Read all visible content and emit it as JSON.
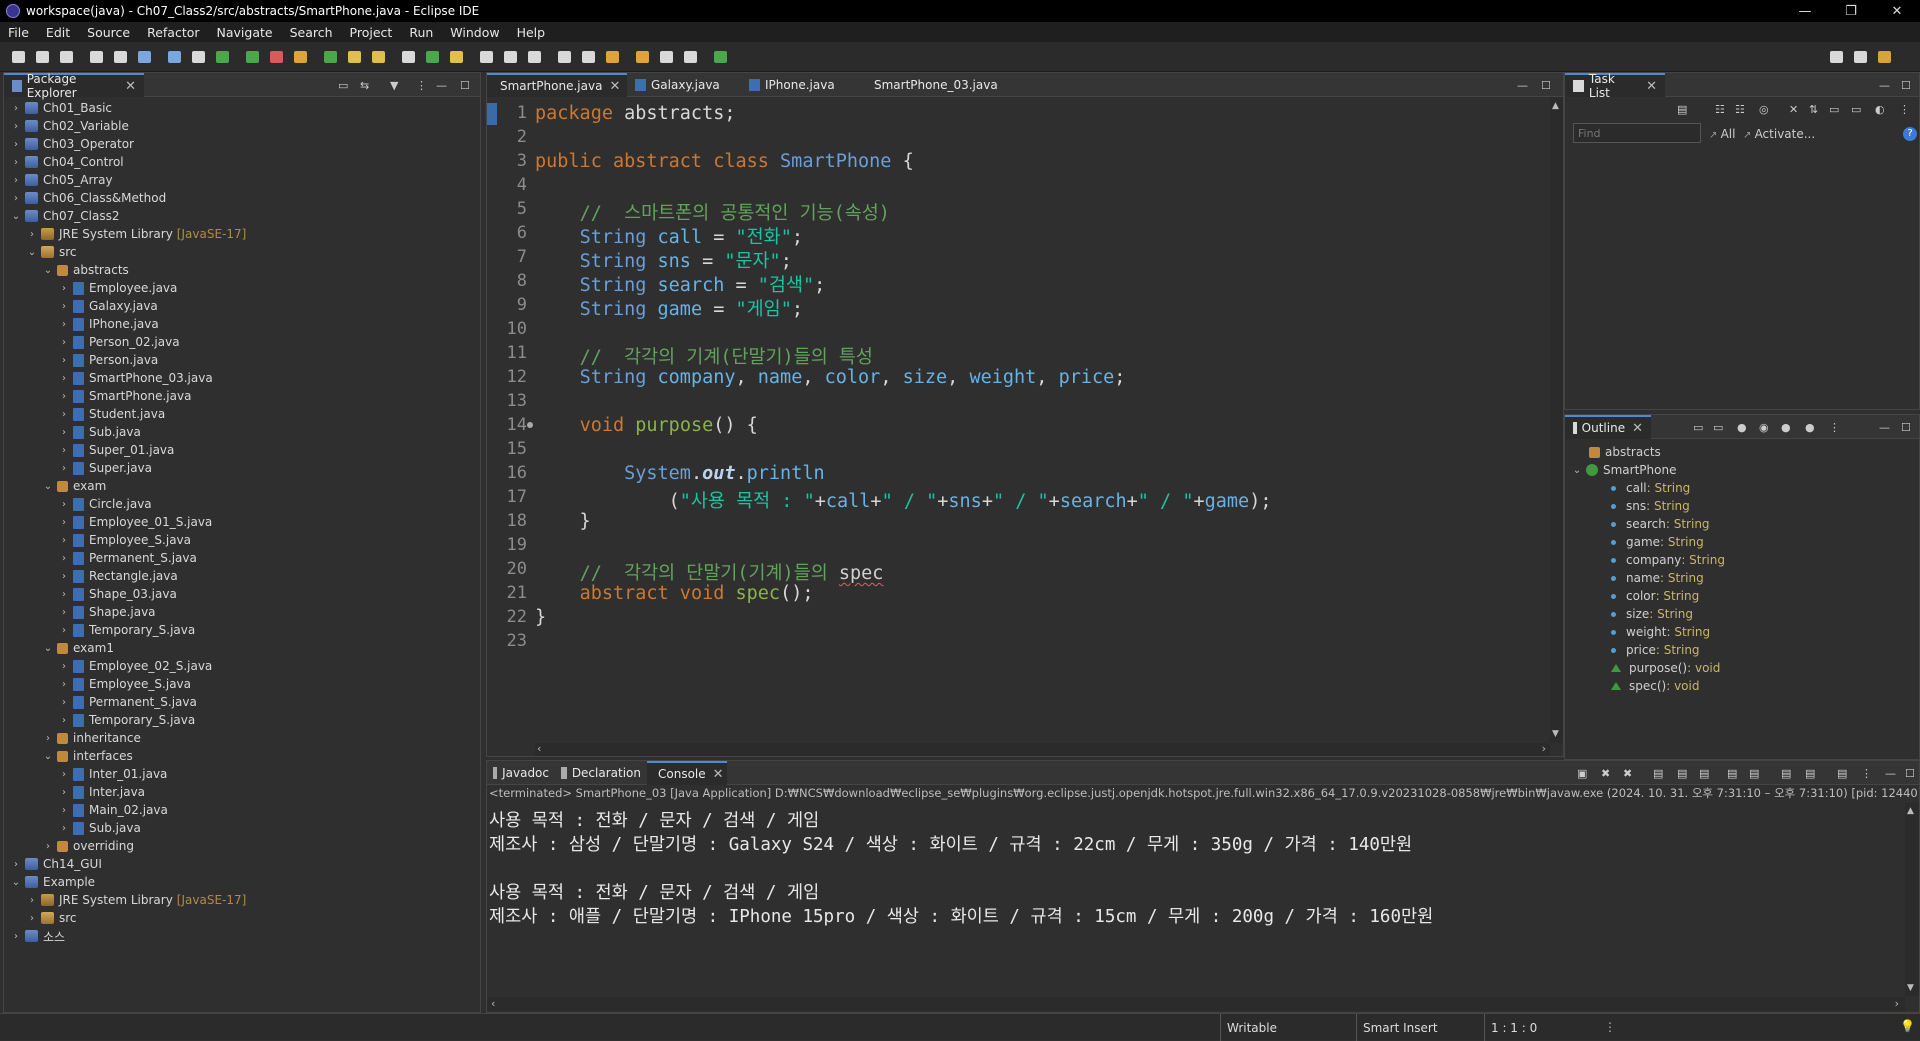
{
  "window": {
    "title": "workspace(java) - Ch07_Class2/src/abstracts/SmartPhone.java - Eclipse IDE",
    "min": "—",
    "max": "❐",
    "close": "✕"
  },
  "menu": [
    "File",
    "Edit",
    "Source",
    "Refactor",
    "Navigate",
    "Search",
    "Project",
    "Run",
    "Window",
    "Help"
  ],
  "explorer": {
    "title": "Package Explorer",
    "rows": [
      {
        "chev": "›",
        "icon": "proj",
        "label": "Ch01_Basic",
        "indent": 0
      },
      {
        "chev": "›",
        "icon": "proj",
        "label": "Ch02_Variable",
        "indent": 0
      },
      {
        "chev": "›",
        "icon": "proj",
        "label": "Ch03_Operator",
        "indent": 0
      },
      {
        "chev": "›",
        "icon": "proj",
        "label": "Ch04_Control",
        "indent": 0
      },
      {
        "chev": "›",
        "icon": "proj",
        "label": "Ch05_Array",
        "indent": 0
      },
      {
        "chev": "›",
        "icon": "proj",
        "label": "Ch06_Class&Method",
        "indent": 0
      },
      {
        "chev": "⌄",
        "icon": "proj",
        "label": "Ch07_Class2",
        "indent": 0
      },
      {
        "chev": "›",
        "icon": "jre",
        "label": "JRE System Library",
        "tag": "[JavaSE-17]",
        "indent": 1
      },
      {
        "chev": "⌄",
        "icon": "src",
        "label": "src",
        "indent": 1
      },
      {
        "chev": "⌄",
        "icon": "pkg",
        "label": "abstracts",
        "indent": 2
      },
      {
        "chev": "›",
        "icon": "java",
        "label": "Employee.java",
        "indent": 3
      },
      {
        "chev": "›",
        "icon": "java",
        "label": "Galaxy.java",
        "indent": 3
      },
      {
        "chev": "›",
        "icon": "java",
        "label": "IPhone.java",
        "indent": 3
      },
      {
        "chev": "›",
        "icon": "java",
        "label": "Person_02.java",
        "indent": 3
      },
      {
        "chev": "›",
        "icon": "java",
        "label": "Person.java",
        "indent": 3
      },
      {
        "chev": "›",
        "icon": "java",
        "label": "SmartPhone_03.java",
        "indent": 3
      },
      {
        "chev": "›",
        "icon": "java",
        "label": "SmartPhone.java",
        "indent": 3
      },
      {
        "chev": "›",
        "icon": "java",
        "label": "Student.java",
        "indent": 3
      },
      {
        "chev": "›",
        "icon": "java",
        "label": "Sub.java",
        "indent": 3
      },
      {
        "chev": "›",
        "icon": "java",
        "label": "Super_01.java",
        "indent": 3
      },
      {
        "chev": "›",
        "icon": "java",
        "label": "Super.java",
        "indent": 3
      },
      {
        "chev": "⌄",
        "icon": "pkg",
        "label": "exam",
        "indent": 2
      },
      {
        "chev": "›",
        "icon": "java",
        "label": "Circle.java",
        "indent": 3
      },
      {
        "chev": "›",
        "icon": "java",
        "label": "Employee_01_S.java",
        "indent": 3
      },
      {
        "chev": "›",
        "icon": "java",
        "label": "Employee_S.java",
        "indent": 3
      },
      {
        "chev": "›",
        "icon": "java",
        "label": "Permanent_S.java",
        "indent": 3
      },
      {
        "chev": "›",
        "icon": "java",
        "label": "Rectangle.java",
        "indent": 3
      },
      {
        "chev": "›",
        "icon": "java",
        "label": "Shape_03.java",
        "indent": 3
      },
      {
        "chev": "›",
        "icon": "java",
        "label": "Shape.java",
        "indent": 3
      },
      {
        "chev": "›",
        "icon": "java",
        "label": "Temporary_S.java",
        "indent": 3
      },
      {
        "chev": "⌄",
        "icon": "pkg",
        "label": "exam1",
        "indent": 2
      },
      {
        "chev": "›",
        "icon": "java",
        "label": "Employee_02_S.java",
        "indent": 3
      },
      {
        "chev": "›",
        "icon": "java",
        "label": "Employee_S.java",
        "indent": 3
      },
      {
        "chev": "›",
        "icon": "java",
        "label": "Permanent_S.java",
        "indent": 3
      },
      {
        "chev": "›",
        "icon": "java",
        "label": "Temporary_S.java",
        "indent": 3
      },
      {
        "chev": "›",
        "icon": "pkg",
        "label": "inheritance",
        "indent": 2
      },
      {
        "chev": "⌄",
        "icon": "pkg",
        "label": "interfaces",
        "indent": 2
      },
      {
        "chev": "›",
        "icon": "java",
        "label": "Inter_01.java",
        "indent": 3
      },
      {
        "chev": "›",
        "icon": "java",
        "label": "Inter.java",
        "indent": 3
      },
      {
        "chev": "›",
        "icon": "java",
        "label": "Main_02.java",
        "indent": 3
      },
      {
        "chev": "›",
        "icon": "java",
        "label": "Sub.java",
        "indent": 3
      },
      {
        "chev": "›",
        "icon": "pkg",
        "label": "overriding",
        "indent": 2
      },
      {
        "chev": "›",
        "icon": "proj",
        "label": "Ch14_GUI",
        "indent": 0
      },
      {
        "chev": "⌄",
        "icon": "proj",
        "label": "Example",
        "indent": 0
      },
      {
        "chev": "›",
        "icon": "jre",
        "label": "JRE System Library",
        "tag": "[JavaSE-17]",
        "indent": 1
      },
      {
        "chev": "›",
        "icon": "src",
        "label": "src",
        "indent": 1
      },
      {
        "chev": "›",
        "icon": "proj",
        "label": "소스",
        "indent": 0
      }
    ]
  },
  "editor": {
    "tabs": [
      "SmartPhone.java",
      "Galaxy.java",
      "IPhone.java",
      "SmartPhone_03.java"
    ],
    "lines": [
      [
        [
          "kw",
          "package"
        ],
        [
          "pl",
          " abstracts;"
        ]
      ],
      [],
      [
        [
          "kw",
          "public abstract class "
        ],
        [
          "ty",
          "SmartPhone"
        ],
        [
          "pl",
          " {"
        ]
      ],
      [],
      [
        [
          "pl",
          "    "
        ],
        [
          "cm",
          "//  스마트폰의 공통적인 기능(속성)"
        ]
      ],
      [
        [
          "pl",
          "    "
        ],
        [
          "ty",
          "String"
        ],
        [
          "pl",
          " "
        ],
        [
          "var",
          "call"
        ],
        [
          "pl",
          " = "
        ],
        [
          "st",
          "\"전화\""
        ],
        [
          "pl",
          ";"
        ]
      ],
      [
        [
          "pl",
          "    "
        ],
        [
          "ty",
          "String"
        ],
        [
          "pl",
          " "
        ],
        [
          "var",
          "sns"
        ],
        [
          "pl",
          " = "
        ],
        [
          "st",
          "\"문자\""
        ],
        [
          "pl",
          ";"
        ]
      ],
      [
        [
          "pl",
          "    "
        ],
        [
          "ty",
          "String"
        ],
        [
          "pl",
          " "
        ],
        [
          "var",
          "search"
        ],
        [
          "pl",
          " = "
        ],
        [
          "st",
          "\"검색\""
        ],
        [
          "pl",
          ";"
        ]
      ],
      [
        [
          "pl",
          "    "
        ],
        [
          "ty",
          "String"
        ],
        [
          "pl",
          " "
        ],
        [
          "var",
          "game"
        ],
        [
          "pl",
          " = "
        ],
        [
          "st",
          "\"게임\""
        ],
        [
          "pl",
          ";"
        ]
      ],
      [],
      [
        [
          "pl",
          "    "
        ],
        [
          "cm",
          "//  각각의 기계(단말기)들의 특성"
        ]
      ],
      [
        [
          "pl",
          "    "
        ],
        [
          "ty",
          "String"
        ],
        [
          "pl",
          " "
        ],
        [
          "var",
          "company"
        ],
        [
          "pl",
          ", "
        ],
        [
          "var",
          "name"
        ],
        [
          "pl",
          ", "
        ],
        [
          "var",
          "color"
        ],
        [
          "pl",
          ", "
        ],
        [
          "var",
          "size"
        ],
        [
          "pl",
          ", "
        ],
        [
          "var",
          "weight"
        ],
        [
          "pl",
          ", "
        ],
        [
          "var",
          "price"
        ],
        [
          "pl",
          ";"
        ]
      ],
      [],
      [
        [
          "pl",
          "    "
        ],
        [
          "kw",
          "void"
        ],
        [
          "pl",
          " "
        ],
        [
          "fn",
          "purpose"
        ],
        [
          "pl",
          "() {"
        ]
      ],
      [],
      [
        [
          "pl",
          "        "
        ],
        [
          "ty",
          "System"
        ],
        [
          "pl",
          "."
        ],
        [
          "ital",
          "out"
        ],
        [
          "pl",
          "."
        ],
        [
          "var",
          "println"
        ]
      ],
      [
        [
          "pl",
          "            ("
        ],
        [
          "st",
          "\"사용 목적 : \""
        ],
        [
          "pl",
          "+"
        ],
        [
          "var",
          "call"
        ],
        [
          "pl",
          "+"
        ],
        [
          "st",
          "\" / \""
        ],
        [
          "pl",
          "+"
        ],
        [
          "var",
          "sns"
        ],
        [
          "pl",
          "+"
        ],
        [
          "st",
          "\" / \""
        ],
        [
          "pl",
          "+"
        ],
        [
          "var",
          "search"
        ],
        [
          "pl",
          "+"
        ],
        [
          "st",
          "\" / \""
        ],
        [
          "pl",
          "+"
        ],
        [
          "var",
          "game"
        ],
        [
          "pl",
          ");"
        ]
      ],
      [
        [
          "pl",
          "    }"
        ]
      ],
      [],
      [
        [
          "pl",
          "    "
        ],
        [
          "cm",
          "//  각각의 단말기(기계)들의 "
        ],
        [
          "squig",
          "spec"
        ]
      ],
      [
        [
          "pl",
          "    "
        ],
        [
          "kw",
          "abstract void "
        ],
        [
          "fn",
          "spec"
        ],
        [
          "pl",
          "();"
        ]
      ],
      [
        [
          "pl",
          "}"
        ]
      ],
      []
    ]
  },
  "tasklist": {
    "title": "Task List",
    "find_placeholder": "Find",
    "all": "All",
    "activate": "Activate..."
  },
  "outline": {
    "title": "Outline",
    "package": "abstracts",
    "class": "SmartPhone",
    "members": [
      {
        "kind": "field",
        "name": "call",
        "type": " : String"
      },
      {
        "kind": "field",
        "name": "sns",
        "type": " : String"
      },
      {
        "kind": "field",
        "name": "search",
        "type": " : String"
      },
      {
        "kind": "field",
        "name": "game",
        "type": " : String"
      },
      {
        "kind": "field",
        "name": "company",
        "type": " : String"
      },
      {
        "kind": "field",
        "name": "name",
        "type": " : String"
      },
      {
        "kind": "field",
        "name": "color",
        "type": " : String"
      },
      {
        "kind": "field",
        "name": "size",
        "type": " : String"
      },
      {
        "kind": "field",
        "name": "weight",
        "type": " : String"
      },
      {
        "kind": "field",
        "name": "price",
        "type": " : String"
      },
      {
        "kind": "method",
        "name": "purpose()",
        "type": " : void"
      },
      {
        "kind": "method",
        "name": "spec()",
        "type": " : void"
      }
    ]
  },
  "console": {
    "tabs": [
      "Javadoc",
      "Declaration",
      "Console"
    ],
    "header": "<terminated> SmartPhone_03 [Java Application] D:₩NCS₩download₩eclipse_se₩plugins₩org.eclipse.justj.openjdk.hotspot.jre.full.win32.x86_64_17.0.9.v20231028-0858₩jre₩bin₩javaw.exe  (2024. 10. 31. 오후 7:31:10 – 오후 7:31:10) [pid: 12440]",
    "lines": [
      "사용 목적 : 전화 / 문자 / 검색 / 게임",
      "제조사 : 삼성 / 단말기명 : Galaxy S24 / 색상 : 화이트 / 규격 : 22cm / 무게 : 350g / 가격 : 140만원",
      "",
      "사용 목적 : 전화 / 문자 / 검색 / 게임",
      "제조사 : 애플 / 단말기명 : IPhone 15pro / 색상 : 화이트 / 규격 : 15cm / 무게 : 200g / 가격 : 160만원"
    ]
  },
  "status": {
    "writable": "Writable",
    "insert": "Smart Insert",
    "position": "1 : 1 : 0"
  }
}
